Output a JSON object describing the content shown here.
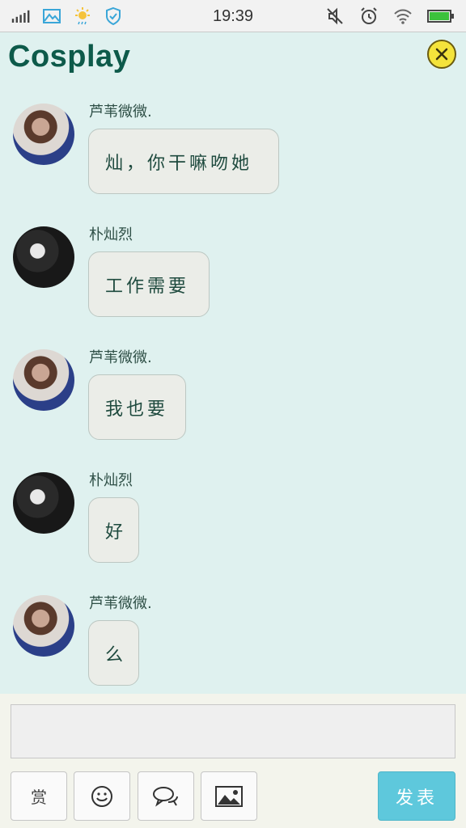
{
  "status_bar": {
    "time": "19:39",
    "left_icons": [
      "signal-icon",
      "image-icon",
      "weather-icon",
      "shield-icon"
    ],
    "right_icons": [
      "mute-icon",
      "alarm-icon",
      "wifi-icon",
      "battery-icon"
    ]
  },
  "header": {
    "title": "Cosplay",
    "close_icon": "close-icon"
  },
  "messages": [
    {
      "sender": "芦苇微微.",
      "text": "灿，你干嘛吻她",
      "avatar": "female"
    },
    {
      "sender": "朴灿烈",
      "text": "工作需要",
      "avatar": "male"
    },
    {
      "sender": "芦苇微微.",
      "text": "我也要",
      "avatar": "female"
    },
    {
      "sender": "朴灿烈",
      "text": "好",
      "avatar": "male"
    },
    {
      "sender": "芦苇微微.",
      "text": "么",
      "avatar": "female"
    }
  ],
  "composer": {
    "input_value": "",
    "tools": {
      "reward_label": "赏",
      "emoji_icon": "smiley-icon",
      "chat_icon": "chat-bubbles-icon",
      "image_icon": "picture-icon"
    },
    "send_label": "发表"
  },
  "colors": {
    "background": "#dff1ef",
    "title": "#0d5a4a",
    "send_button": "#5ec8dc",
    "close_button": "#f4e33b"
  }
}
